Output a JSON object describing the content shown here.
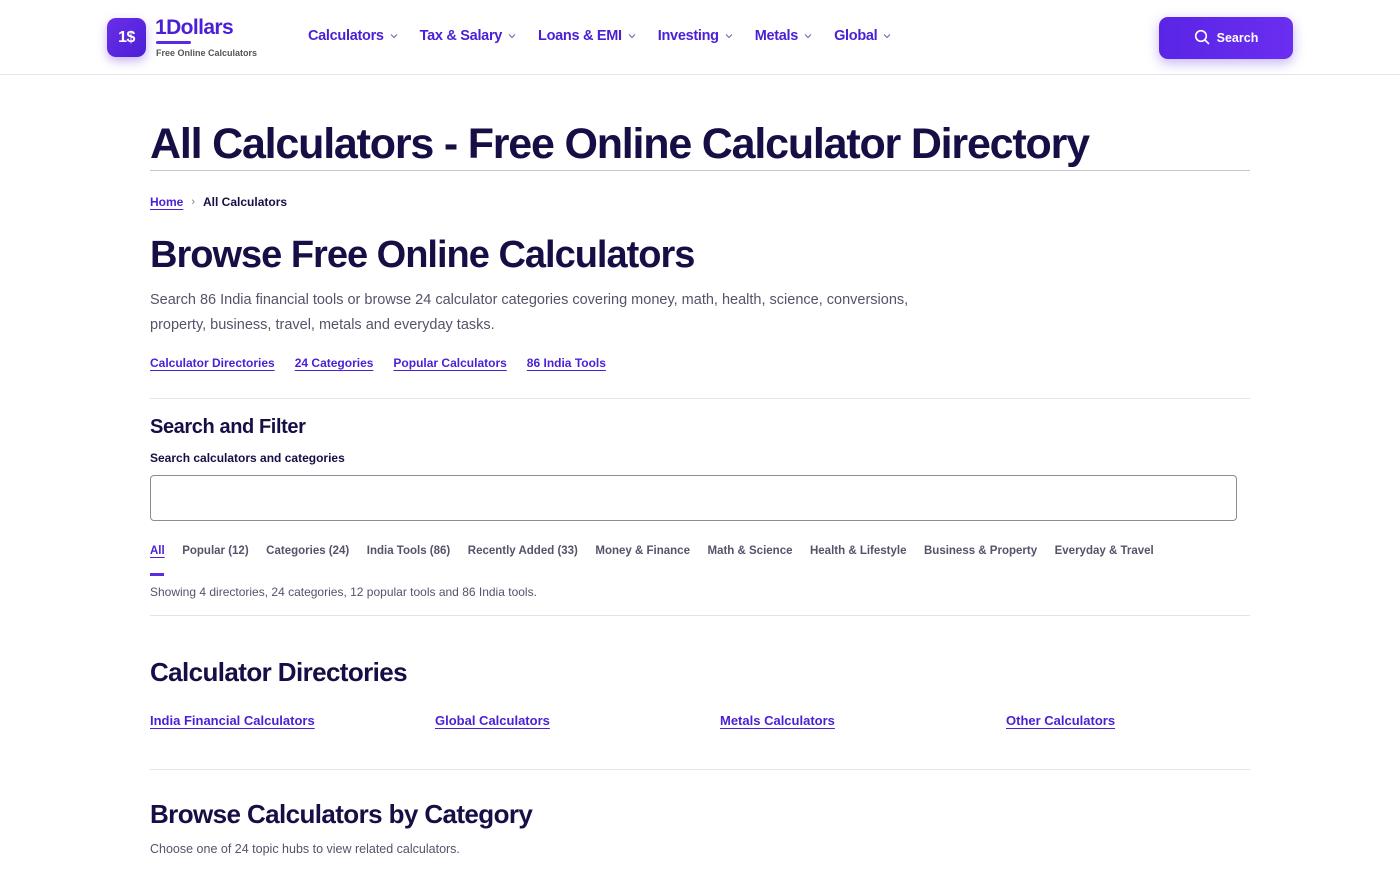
{
  "header": {
    "logo_badge": "1$",
    "logo_name": "1Dollars",
    "logo_tagline": "Free Online Calculators",
    "nav": [
      {
        "label": "Calculators"
      },
      {
        "label": "Tax & Salary"
      },
      {
        "label": "Loans & EMI"
      },
      {
        "label": "Investing"
      },
      {
        "label": "Metals"
      },
      {
        "label": "Global"
      }
    ],
    "search_label": "Search",
    "accent_color": "#4a1fd6"
  },
  "page": {
    "title": "All Calculators - Free Online Calculator Directory",
    "breadcrumb": {
      "home": "Home",
      "separator": "›",
      "current": "All Calculators"
    },
    "heading": "Browse Free Online Calculators",
    "intro": "Search 86 India financial tools or browse 24 calculator categories covering money, math, health, science, conversions, property, business, travel, metals and everyday tasks.",
    "quick_links": [
      "Calculator Directories",
      "24 Categories",
      "Popular Calculators",
      "86 India Tools"
    ]
  },
  "search_filter": {
    "heading": "Search and Filter",
    "input_label": "Search calculators and categories",
    "input_value": "",
    "filters": [
      "All",
      "Popular (12)",
      "Categories (24)",
      "India Tools (86)",
      "Recently Added (33)",
      "Money & Finance",
      "Math & Science",
      "Health & Lifestyle",
      "Business & Property",
      "Everyday & Travel"
    ],
    "active_filter": "All",
    "showing_text": "Showing 4 directories, 24 categories, 12 popular tools and 86 India tools."
  },
  "directories": {
    "heading": "Calculator Directories",
    "items": [
      "India Financial Calculators",
      "Global Calculators",
      "Metals Calculators",
      "Other Calculators"
    ]
  },
  "categories": {
    "heading": "Browse Calculators by Category",
    "description": "Choose one of 24 topic hubs to view related calculators."
  }
}
